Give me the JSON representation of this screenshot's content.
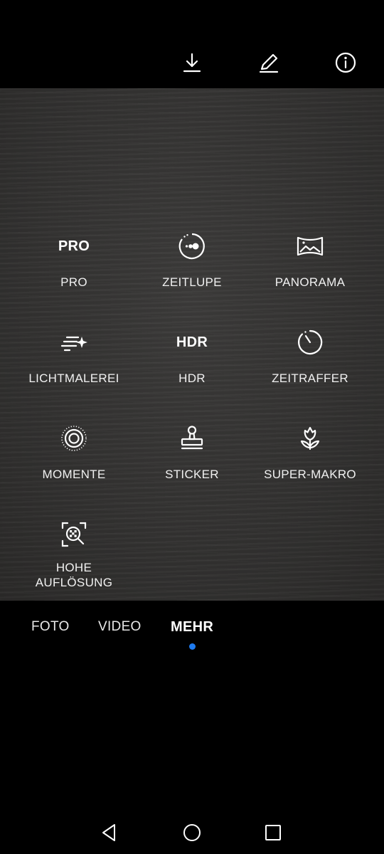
{
  "top_bar": {
    "icons": [
      "download-icon",
      "edit-pencil-icon",
      "info-icon"
    ]
  },
  "modes": [
    {
      "id": "pro",
      "label": "PRO",
      "icon": "pro-text-icon",
      "icon_text": "PRO"
    },
    {
      "id": "zeitlupe",
      "label": "ZEITLUPE",
      "icon": "slow-motion-icon"
    },
    {
      "id": "panorama",
      "label": "PANORAMA",
      "icon": "panorama-icon"
    },
    {
      "id": "lichtmalerei",
      "label": "LICHTMALEREI",
      "icon": "light-painting-icon"
    },
    {
      "id": "hdr",
      "label": "HDR",
      "icon": "hdr-text-icon",
      "icon_text": "HDR"
    },
    {
      "id": "zeitraffer",
      "label": "ZEITRAFFER",
      "icon": "timelapse-icon"
    },
    {
      "id": "momente",
      "label": "MOMENTE",
      "icon": "moments-icon"
    },
    {
      "id": "sticker",
      "label": "STICKER",
      "icon": "sticker-stamp-icon"
    },
    {
      "id": "super_makro",
      "label": "SUPER-MAKRO",
      "icon": "macro-flower-icon"
    },
    {
      "id": "hohe_aufloesung",
      "label_line1": "HOHE",
      "label_line2": "AUFLÖSUNG",
      "icon": "high-resolution-icon"
    }
  ],
  "tabs": [
    {
      "label": "FOTO",
      "active": false
    },
    {
      "label": "VIDEO",
      "active": false
    },
    {
      "label": "MEHR",
      "active": true
    }
  ],
  "colors": {
    "accent_dot": "#1e7bf0",
    "background": "#000000",
    "viewfinder": "#333231"
  },
  "nav_bar": {
    "buttons": [
      "back-triangle-icon",
      "home-circle-icon",
      "recents-square-icon"
    ]
  }
}
